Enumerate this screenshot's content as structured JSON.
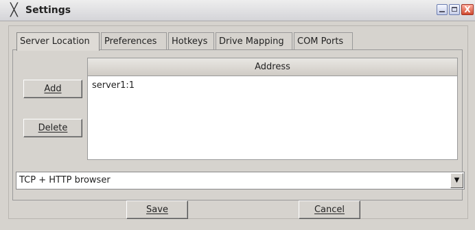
{
  "window": {
    "title": "Settings",
    "app_icon": "x-icon",
    "controls": [
      "minimize-icon",
      "maximize-icon",
      "close-icon"
    ],
    "close_glyph": "X"
  },
  "tabs": [
    {
      "label": "Server Location",
      "active": true
    },
    {
      "label": "Preferences",
      "active": false
    },
    {
      "label": "Hotkeys",
      "active": false
    },
    {
      "label": "Drive Mapping",
      "active": false
    },
    {
      "label": "COM Ports",
      "active": false
    }
  ],
  "server_location": {
    "add_label": "Add",
    "delete_label": "Delete",
    "list_header": "Address",
    "items": [
      "server1:1"
    ],
    "protocol": {
      "selected": "TCP + HTTP browser"
    }
  },
  "footer": {
    "save_label": "Save",
    "cancel_label": "Cancel"
  }
}
